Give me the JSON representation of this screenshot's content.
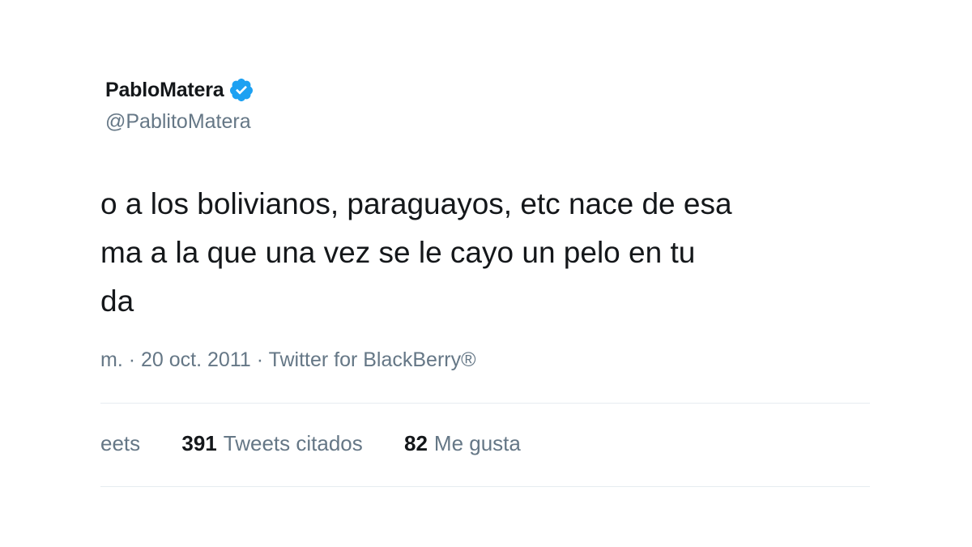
{
  "user": {
    "display_name": "PabloMatera",
    "handle": "@PablitoMatera",
    "verified_icon": "verified-badge-icon",
    "verified_color": "#1da1f2"
  },
  "tweet": {
    "lines": [
      "o a los bolivianos, paraguayos, etc nace de esa",
      "ma a la que una vez se le cayo un pelo en tu",
      "da"
    ]
  },
  "meta": {
    "time_fragment": "m.",
    "separator1": "·",
    "date": "20 oct. 2011",
    "separator2": "·",
    "source": "Twitter for BlackBerry®"
  },
  "stats": {
    "retweets_label": "eets",
    "quote_count": "391",
    "quote_label": "Tweets citados",
    "likes_count": "82",
    "likes_label": "Me gusta"
  }
}
